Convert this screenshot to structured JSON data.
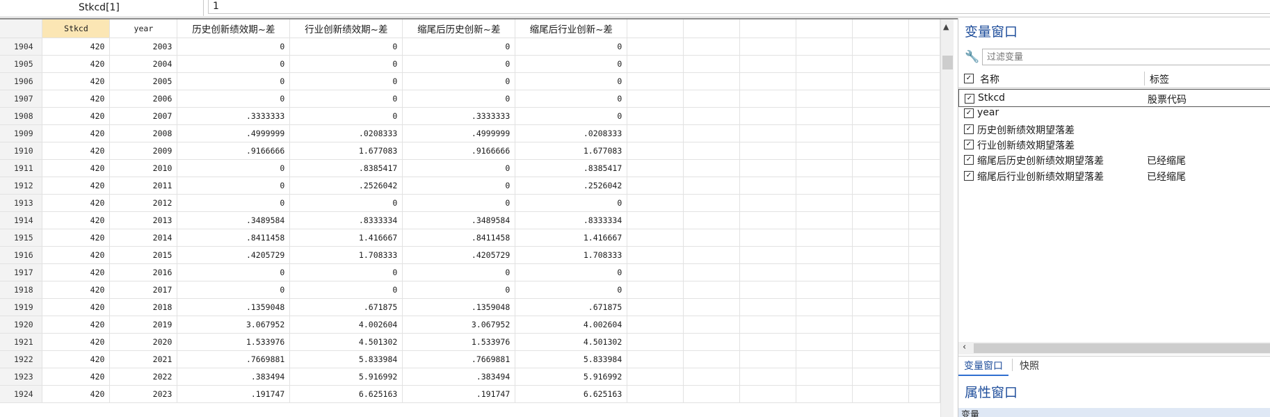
{
  "refbar": {
    "cell_ref": "Stkcd[1]",
    "cell_value": "1"
  },
  "grid": {
    "headers": [
      "Stkcd",
      "year",
      "历史创新绩效期~差",
      "行业创新绩效期~差",
      "缩尾后历史创新~差",
      "缩尾后行业创新~差"
    ],
    "rows": [
      [
        "1904",
        "420",
        "2003",
        "0",
        "0",
        "0",
        "0"
      ],
      [
        "1905",
        "420",
        "2004",
        "0",
        "0",
        "0",
        "0"
      ],
      [
        "1906",
        "420",
        "2005",
        "0",
        "0",
        "0",
        "0"
      ],
      [
        "1907",
        "420",
        "2006",
        "0",
        "0",
        "0",
        "0"
      ],
      [
        "1908",
        "420",
        "2007",
        ".3333333",
        "0",
        ".3333333",
        "0"
      ],
      [
        "1909",
        "420",
        "2008",
        ".4999999",
        ".0208333",
        ".4999999",
        ".0208333"
      ],
      [
        "1910",
        "420",
        "2009",
        ".9166666",
        "1.677083",
        ".9166666",
        "1.677083"
      ],
      [
        "1911",
        "420",
        "2010",
        "0",
        ".8385417",
        "0",
        ".8385417"
      ],
      [
        "1912",
        "420",
        "2011",
        "0",
        ".2526042",
        "0",
        ".2526042"
      ],
      [
        "1913",
        "420",
        "2012",
        "0",
        "0",
        "0",
        "0"
      ],
      [
        "1914",
        "420",
        "2013",
        ".3489584",
        ".8333334",
        ".3489584",
        ".8333334"
      ],
      [
        "1915",
        "420",
        "2014",
        ".8411458",
        "1.416667",
        ".8411458",
        "1.416667"
      ],
      [
        "1916",
        "420",
        "2015",
        ".4205729",
        "1.708333",
        ".4205729",
        "1.708333"
      ],
      [
        "1917",
        "420",
        "2016",
        "0",
        "0",
        "0",
        "0"
      ],
      [
        "1918",
        "420",
        "2017",
        "0",
        "0",
        "0",
        "0"
      ],
      [
        "1919",
        "420",
        "2018",
        ".1359048",
        ".671875",
        ".1359048",
        ".671875"
      ],
      [
        "1920",
        "420",
        "2019",
        "3.067952",
        "4.002604",
        "3.067952",
        "4.002604"
      ],
      [
        "1921",
        "420",
        "2020",
        "1.533976",
        "4.501302",
        "1.533976",
        "4.501302"
      ],
      [
        "1922",
        "420",
        "2021",
        ".7669881",
        "5.833984",
        ".7669881",
        "5.833984"
      ],
      [
        "1923",
        "420",
        "2022",
        ".383494",
        "5.916992",
        ".383494",
        "5.916992"
      ],
      [
        "1924",
        "420",
        "2023",
        ".191747",
        "6.625163",
        ".191747",
        "6.625163"
      ]
    ]
  },
  "variables_panel": {
    "title": "变量窗口",
    "filter_placeholder": "过滤变量",
    "col_name": "名称",
    "col_label": "标签",
    "variables": [
      {
        "name": "Stkcd",
        "label": "股票代码"
      },
      {
        "name": "year",
        "label": ""
      },
      {
        "name": "历史创新绩效期望落差",
        "label": ""
      },
      {
        "name": "行业创新绩效期望落差",
        "label": ""
      },
      {
        "name": "缩尾后历史创新绩效期望落差",
        "label": "已经缩尾"
      },
      {
        "name": "缩尾后行业创新绩效期望落差",
        "label": "已经缩尾"
      }
    ],
    "tabs": [
      "变量窗口",
      "快照"
    ]
  },
  "properties_panel": {
    "title": "属性窗口",
    "section": "变量"
  }
}
